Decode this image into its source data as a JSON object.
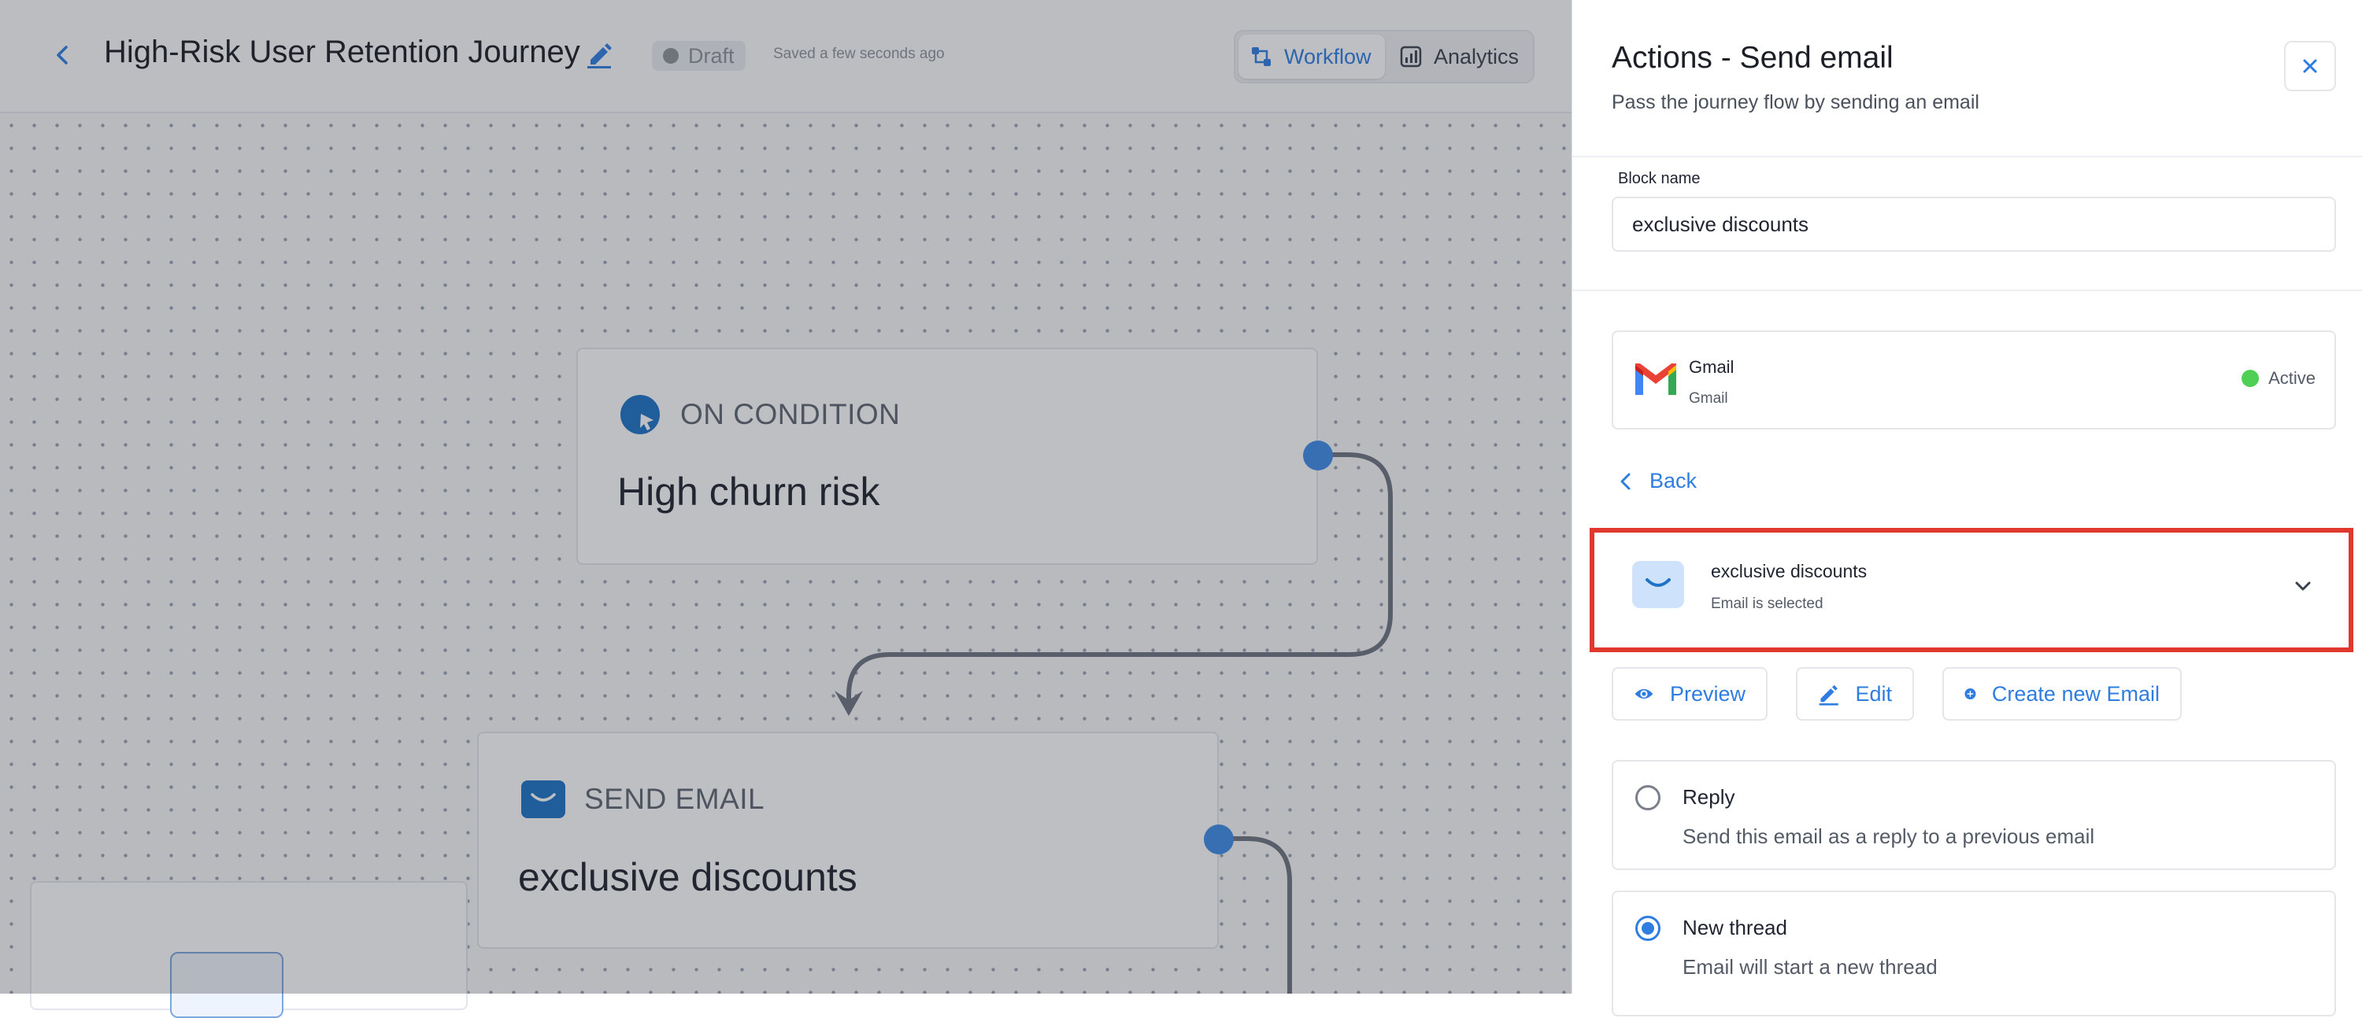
{
  "topbar": {
    "title": "High-Risk User Retention Journey",
    "status_badge": "Draft",
    "saved_text": "Saved a few seconds ago",
    "tabs": [
      {
        "label": "Workflow",
        "active": true,
        "icon": "workflow-icon"
      },
      {
        "label": "Analytics",
        "active": false,
        "icon": "analytics-icon"
      }
    ]
  },
  "nodes": [
    {
      "type_label": "ON CONDITION",
      "title": "High churn risk",
      "icon": "condition-icon"
    },
    {
      "type_label": "SEND EMAIL",
      "title": "exclusive discounts",
      "icon": "mail-icon"
    }
  ],
  "panel": {
    "title": "Actions - Send email",
    "subtitle": "Pass the journey flow by sending an email",
    "block_name_label": "Block name",
    "block_name_value": "exclusive discounts",
    "integration": {
      "name": "Gmail",
      "subtitle": "Gmail",
      "status": "Active"
    },
    "back_label": "Back",
    "selected_email": {
      "name": "exclusive discounts",
      "subtitle": "Email is selected"
    },
    "buttons": {
      "preview": "Preview",
      "edit": "Edit",
      "create": "Create new Email"
    },
    "options": [
      {
        "title": "Reply",
        "description": "Send this email as a reply to a previous email",
        "selected": false
      },
      {
        "title": "New thread",
        "description": "Email will start a new thread",
        "selected": true
      }
    ]
  },
  "colors": {
    "accent": "#2f7de1",
    "highlight": "#e0382c",
    "active_status": "#4fcf54"
  }
}
